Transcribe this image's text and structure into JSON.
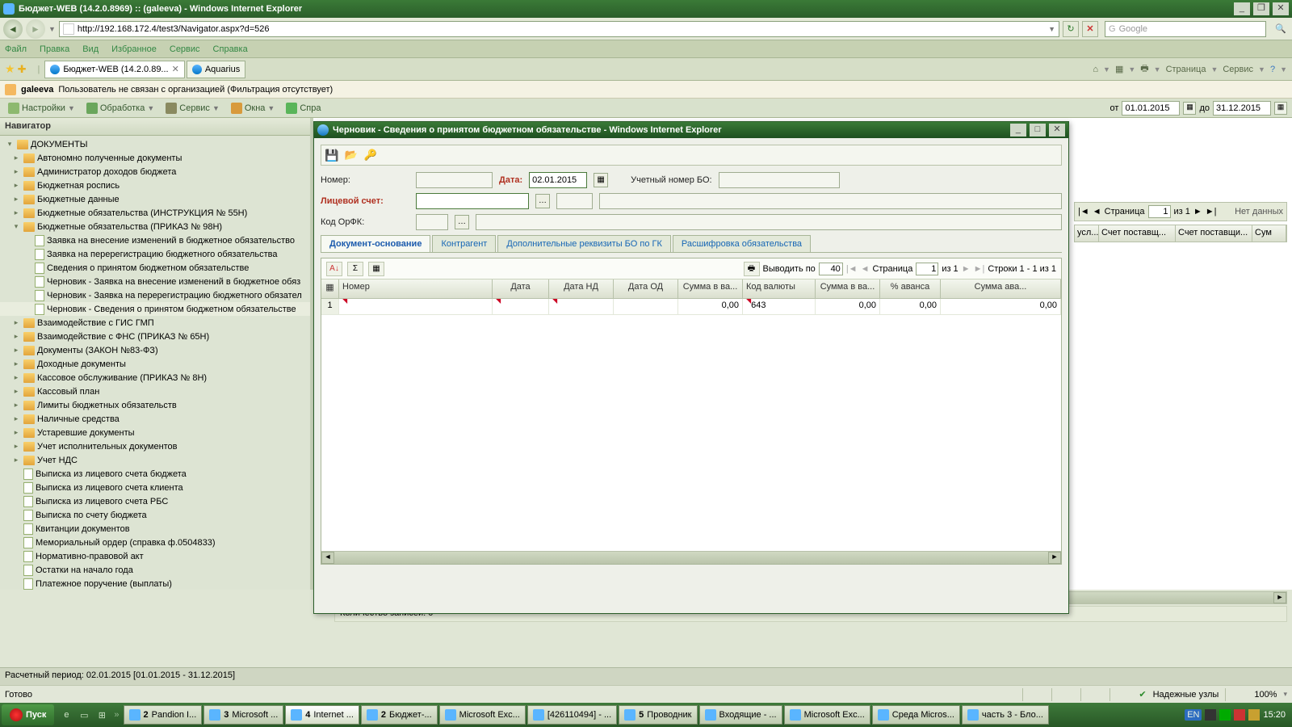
{
  "window": {
    "title": "Бюджет-WEB (14.2.0.8969) :: (galeeva) - Windows Internet Explorer"
  },
  "nav": {
    "url": "http://192.168.172.4/test3/Navigator.aspx?d=526",
    "search_placeholder": "Google"
  },
  "menu": [
    "Файл",
    "Правка",
    "Вид",
    "Избранное",
    "Сервис",
    "Справка"
  ],
  "tabs": [
    {
      "label": "Бюджет-WEB (14.2.0.89...",
      "active": true,
      "closable": true
    },
    {
      "label": "Aquarius",
      "active": false,
      "closable": false
    }
  ],
  "rtools": [
    "Страница",
    "Сервис"
  ],
  "userbar": {
    "user": "galeeva",
    "msg": "Пользователь не связан с организацией (Фильтрация отсутствует)"
  },
  "actionbar": {
    "items": [
      "Настройки",
      "Обработка",
      "Сервис",
      "Окна",
      "Спра"
    ],
    "from_lbl": "от",
    "to_lbl": "до",
    "from": "01.01.2015",
    "to": "31.12.2015"
  },
  "navigator": {
    "title": "Навигатор",
    "root": "ДОКУМЕНТЫ",
    "folders1": [
      "Автономно полученные документы",
      "Администратор доходов бюджета",
      "Бюджетная роспись",
      "Бюджетные данные",
      "Бюджетные обязательства (ИНСТРУКЦИЯ № 55Н)"
    ],
    "expanded": "Бюджетные обязательства (ПРИКАЗ № 98Н)",
    "docs": [
      "Заявка на внесение изменений в бюджетное обязательство",
      "Заявка на перерегистрацию бюджетного обязательства",
      "Сведения о принятом бюджетном обязательстве",
      "Черновик - Заявка на внесение изменений в бюджетное обяз",
      "Черновик - Заявка на перерегистрацию бюджетного обязател",
      "Черновик - Сведения о принятом бюджетном обязательстве"
    ],
    "folders2": [
      "Взаимодействие с ГИС ГМП",
      "Взаимодействие с ФНС (ПРИКАЗ № 65Н)",
      "Документы (ЗАКОН №83-ФЗ)",
      "Доходные документы",
      "Кассовое обслуживание (ПРИКАЗ № 8Н)",
      "Кассовый план",
      "Лимиты бюджетных обязательств",
      "Наличные средства",
      "Устаревшие документы",
      "Учет исполнительных документов",
      "Учет НДС"
    ],
    "docs2": [
      "Выписка из лицевого счета бюджета",
      "Выписка из лицевого счета клиента",
      "Выписка из лицевого счета РБС",
      "Выписка по счету бюджета",
      "Квитанции документов",
      "Мемориальный ордер (справка ф.0504833)",
      "Нормативно-правовой акт",
      "Остатки на начало года",
      "Платежное поручение (выплаты)"
    ]
  },
  "status_period": "Расчетный период: 02.01.2015 [01.01.2015 - 31.12.2015]",
  "ie_status": {
    "ready": "Готово",
    "trusted": "Надежные узлы",
    "zoom": "100%"
  },
  "taskbar": {
    "start": "Пуск",
    "buttons": [
      {
        "n": "2",
        "t": "Pandion I..."
      },
      {
        "n": "3",
        "t": "Microsoft ..."
      },
      {
        "n": "4",
        "t": "Internet ...",
        "act": true
      },
      {
        "n": "2",
        "t": "Бюджет-..."
      },
      {
        "n": "",
        "t": "Microsoft Exc..."
      },
      {
        "n": "",
        "t": "[426110494] - ..."
      },
      {
        "n": "5",
        "t": "Проводник"
      },
      {
        "n": "",
        "t": "Входящие - ..."
      },
      {
        "n": "",
        "t": "Microsoft Exc..."
      },
      {
        "n": "",
        "t": "Среда Micros..."
      },
      {
        "n": "",
        "t": "часть 3 - Бло..."
      }
    ],
    "lang": "EN",
    "clock": "15:20"
  },
  "popup": {
    "title": "Черновик - Сведения о принятом бюджетном обязательстве - Windows Internet Explorer",
    "labels": {
      "number": "Номер:",
      "date": "Дата:",
      "uchnum": "Учетный номер БО:",
      "ls": "Лицевой счет:",
      "orfk": "Код ОрФК:"
    },
    "date": "02.01.2015",
    "tabs": [
      "Документ-основание",
      "Контрагент",
      "Дополнительные реквизиты БО по ГК",
      "Расшифровка обязательства"
    ],
    "grid": {
      "show_by_lbl": "Выводить по",
      "show_by": "40",
      "page_lbl": "Страница",
      "page": "1",
      "page_of": "из 1",
      "lines": "Строки 1 - 1 из 1",
      "cols": [
        "",
        "Номер",
        "Дата",
        "Дата НД",
        "Дата ОД",
        "Сумма в ва...",
        "Код валюты",
        "Сумма в ва...",
        "% аванса",
        "Сумма ава..."
      ],
      "row": {
        "idx": "1",
        "sum1": "0,00",
        "cur": "643",
        "sum2": "0,00",
        "pct": "0,00",
        "sum3": "0,00"
      }
    }
  },
  "bg": {
    "cols": [
      "усл...",
      "Счет поставщ...",
      "Счет поставщи...",
      "Сум"
    ],
    "page_lbl": "Страница",
    "page": "1",
    "page_of": "из 1",
    "nodata": "Нет данных",
    "reccount": "Количество записей: 0"
  }
}
